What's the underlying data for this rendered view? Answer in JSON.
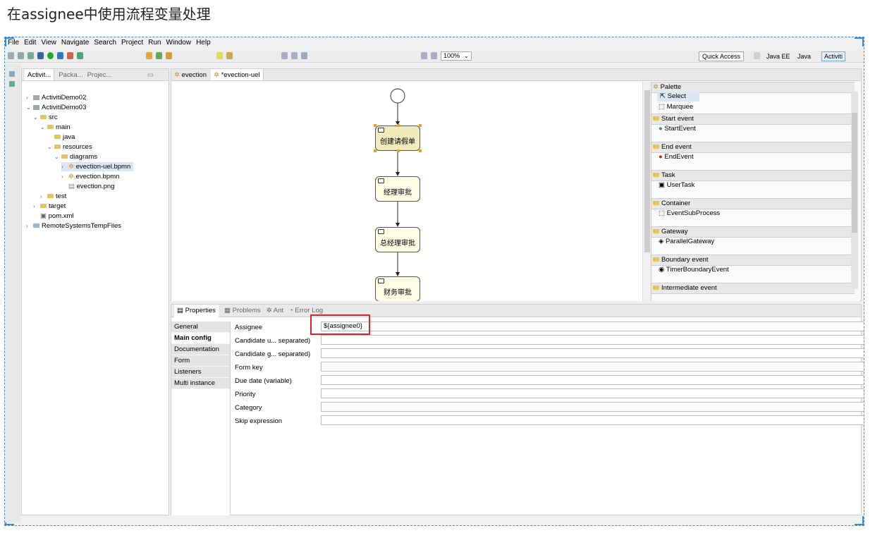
{
  "page_title": "在assignee中使用流程变量处理",
  "menu": [
    "File",
    "Edit",
    "View",
    "Navigate",
    "Search",
    "Project",
    "Run",
    "Window",
    "Help"
  ],
  "toolbar": {
    "zoom": "100%",
    "quick_access": "Quick Access",
    "perspectives": [
      "Java EE",
      "Java",
      "Activiti"
    ]
  },
  "explorer": {
    "tabs": [
      "Activit...",
      "Packa...",
      "Projec..."
    ],
    "tree": [
      "ActivitiDemo02",
      "ActivitiDemo03",
      "src",
      "main",
      "java",
      "resources",
      "diagrams",
      "evection-uel.bpmn",
      "evection.bpmn",
      "evection.png",
      "test",
      "target",
      "pom.xml",
      "RemoteSystemsTempFiles"
    ]
  },
  "editor": {
    "tabs": [
      "evection",
      "*evection-uel"
    ],
    "tasks": [
      "创建请假单",
      "经理审批",
      "总经理审批",
      "财务审批"
    ]
  },
  "palette": {
    "title": "Palette",
    "tools": [
      "Select",
      "Marquee"
    ],
    "groups": [
      {
        "name": "Start event",
        "item": "StartEvent"
      },
      {
        "name": "End event",
        "item": "EndEvent"
      },
      {
        "name": "Task",
        "item": "UserTask"
      },
      {
        "name": "Container",
        "item": "EventSubProcess"
      },
      {
        "name": "Gateway",
        "item": "ParallelGateway"
      },
      {
        "name": "Boundary event",
        "item": "TimerBoundaryEvent"
      },
      {
        "name": "Intermediate event",
        "item": ""
      }
    ]
  },
  "properties": {
    "tabs": [
      "Properties",
      "Problems",
      "Ant",
      "Error Log"
    ],
    "sections": [
      "General",
      "Main config",
      "Documentation",
      "Form",
      "Listeners",
      "Multi instance"
    ],
    "fields": [
      {
        "label": "Assignee",
        "value": "${assignee0}"
      },
      {
        "label": "Candidate u... separated)",
        "value": ""
      },
      {
        "label": "Candidate g... separated)",
        "value": ""
      },
      {
        "label": "Form key",
        "value": ""
      },
      {
        "label": "Due date (variable)",
        "value": ""
      },
      {
        "label": "Priority",
        "value": ""
      },
      {
        "label": "Category",
        "value": ""
      },
      {
        "label": "Skip expression",
        "value": ""
      }
    ]
  },
  "colors": {
    "highlight": "#d9242c",
    "frame": "#2e8de0",
    "task_fill": "#fffde4"
  }
}
